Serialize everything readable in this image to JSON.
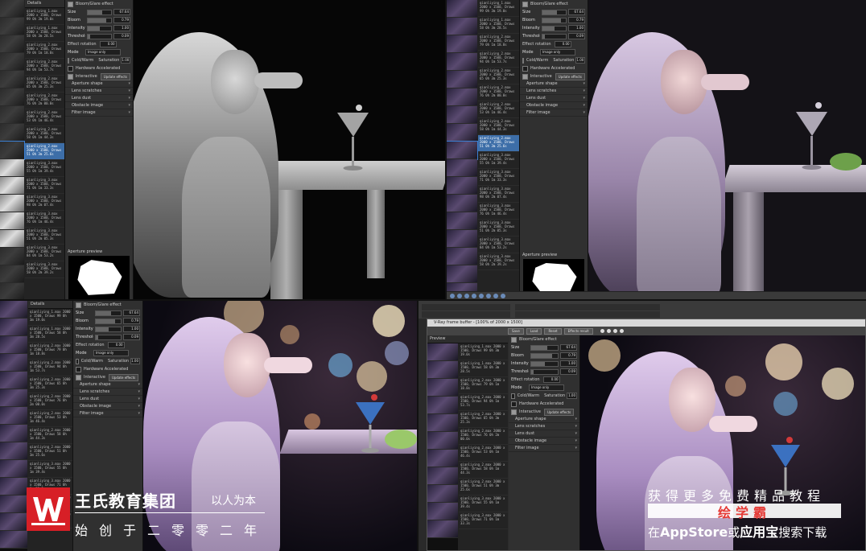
{
  "panel": {
    "section_title": "Bloom/Glare effect",
    "size_label": "Size",
    "size_value": "67.64",
    "bloom_label": "Bloom",
    "bloom_value": "0.79",
    "intensity_label": "Intensity",
    "intensity_value": "1.00",
    "threshold_label": "Threshold",
    "threshold_value": "0.09",
    "rotation_label": "Effect rotation",
    "rotation_value": "0.00",
    "mode_label": "Mode",
    "mode_value": "Image only",
    "coldwarm_label": "Cold/Warm",
    "saturation_label": "Saturation",
    "saturation_value": "1.00",
    "hw_label": "Hardware Accelerated",
    "interactive_label": "Interactive",
    "update_label": "Update effects",
    "sub_items": [
      "Aperture shape",
      "Lens scratches",
      "Lens dust",
      "Obstacle image",
      "Filter image"
    ],
    "aperture_label": "Aperture preview",
    "preview_label": "Preview",
    "details_label": "Details"
  },
  "history": [
    "qianliying_1.max 2000 x 1500, Draws 99 0h 3m 19.0s",
    "qianliying_1.max 2000 x 1500, Draws 58 0h 3m 28.5s",
    "qianliying_2.max 2000 x 1500, Draws 79 0h 1m 18.8s",
    "qianliying_2.max 2000 x 1500, Draws 94 0h 1m 53.7s",
    "qianliying_2.max 2000 x 1500, Draws 65 0h 3m 25.3s",
    "qianliying_2.max 2000 x 1500, Draws 76 0h 2m 00.0s",
    "qianliying_2.max 2000 x 1500, Draws 53 0h 1m 46.4s",
    "qianliying_2.max 2000 x 1500, Draws 58 0h 1m 44.3s",
    "qianliying_2.max 2000 x 1500, Draws 51 0h 3m 25.6s",
    "qianliying_3.max 2000 x 1500, Draws 55 0h 1m 39.4s",
    "qianliying_3.max 2000 x 1500, Draws 71 0h 1m 33.3s",
    "qianliying_3.max 2000 x 1500, Draws 98 0h 2m 07.4s",
    "qianliying_3.max 2000 x 1500, Draws 76 0h 1m 46.4s",
    "qianliying_3.max 2000 x 1500, Draws 51 0h 2m 05.3s",
    "qianliying_3.max 2000 x 1500, Draws 84 0h 1m 53.2s",
    "qianliying_3.max 2000 x 1500, Draws 58 0h 2m 39.2s"
  ],
  "frame_buffer_title": "V-Ray frame buffer - [100% of 2000 x 1500]",
  "fb_buttons": [
    "Save",
    "Load",
    "Reset"
  ],
  "fb_layer": "Effects result",
  "brand": {
    "title": "王氏教育集团",
    "slogan": "以人为本",
    "since": "始创于二零零二年"
  },
  "promo": {
    "line1": "获得更多免费精品教程",
    "app_name": "绘学霸",
    "line2_prefix": "在",
    "line2_store": "AppStore",
    "line2_mid": "或",
    "line2_app": "应用宝",
    "line2_suffix": "搜索下载"
  },
  "colors": {
    "accent": "#3d6ea8",
    "brand_red": "#d71f26",
    "promo_red": "#e53935"
  }
}
